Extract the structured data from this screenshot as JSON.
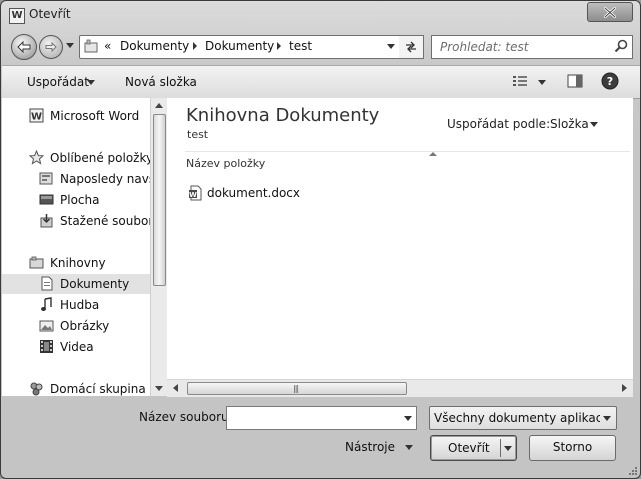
{
  "window": {
    "title": "Otevřít",
    "app_icon_letter": "W"
  },
  "address": {
    "prefix": "«",
    "crumbs": [
      "Dokumenty",
      "Dokumenty",
      "test"
    ]
  },
  "search": {
    "placeholder": "Prohledat: test"
  },
  "toolbar": {
    "organize_label": "Uspořádat",
    "new_folder_label": "Nová složka"
  },
  "nav": {
    "items": [
      {
        "label": "Microsoft Word",
        "icon": "word-icon"
      },
      {
        "label": "Oblíbené položky",
        "icon": "star-icon"
      },
      {
        "label": "Naposledy navštívené",
        "icon": "recent-places-icon"
      },
      {
        "label": "Plocha",
        "icon": "desktop-icon"
      },
      {
        "label": "Stažené soubory",
        "icon": "downloads-icon"
      },
      {
        "label": "Knihovny",
        "icon": "libraries-icon"
      },
      {
        "label": "Dokumenty",
        "icon": "documents-icon",
        "selected": true
      },
      {
        "label": "Hudba",
        "icon": "music-icon"
      },
      {
        "label": "Obrázky",
        "icon": "pictures-icon"
      },
      {
        "label": "Videa",
        "icon": "videos-icon"
      },
      {
        "label": "Domácí skupina",
        "icon": "homegroup-icon"
      }
    ]
  },
  "main": {
    "library_title": "Knihovna Dokumenty",
    "library_subtitle": "test",
    "arrange_label": "Uspořádat podle:",
    "arrange_value": "Složka",
    "column_header": "Název položky",
    "files": [
      {
        "name": "dokument.docx",
        "icon": "word-document-icon"
      }
    ],
    "hscroll_grip": "|||"
  },
  "footer": {
    "filename_label": "Název souboru:",
    "filename_value": "",
    "filter_value": "Všechny dokumenty aplikace Word",
    "tools_label": "Nástroje",
    "open_label": "Otevřít",
    "cancel_label": "Storno"
  }
}
